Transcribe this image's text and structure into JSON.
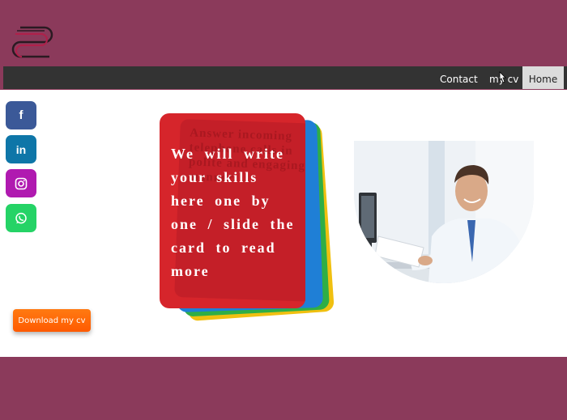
{
  "nav": {
    "contact_label": "Contact",
    "mycv_label": "my cv",
    "home_label": "Home"
  },
  "social": {
    "facebook_icon": "f",
    "linkedin_icon": "in",
    "instagram_icon": "instagram-icon",
    "whatsapp_icon": "whatsapp-icon"
  },
  "card": {
    "text": "We will write your skills here one by one / slide the card to read more",
    "background_text": "Answer incoming telephone calls in polite and engaging manner"
  },
  "download": {
    "label": "Download my cv"
  },
  "colors": {
    "page_bg": "#8b3a5b",
    "navbar_bg": "#333333",
    "card_red": "#d6252b",
    "button_orange": "#ff6a00",
    "facebook": "#3b5998",
    "linkedin": "#0e76a8",
    "instagram": "#b01ab0",
    "whatsapp": "#25d366"
  }
}
